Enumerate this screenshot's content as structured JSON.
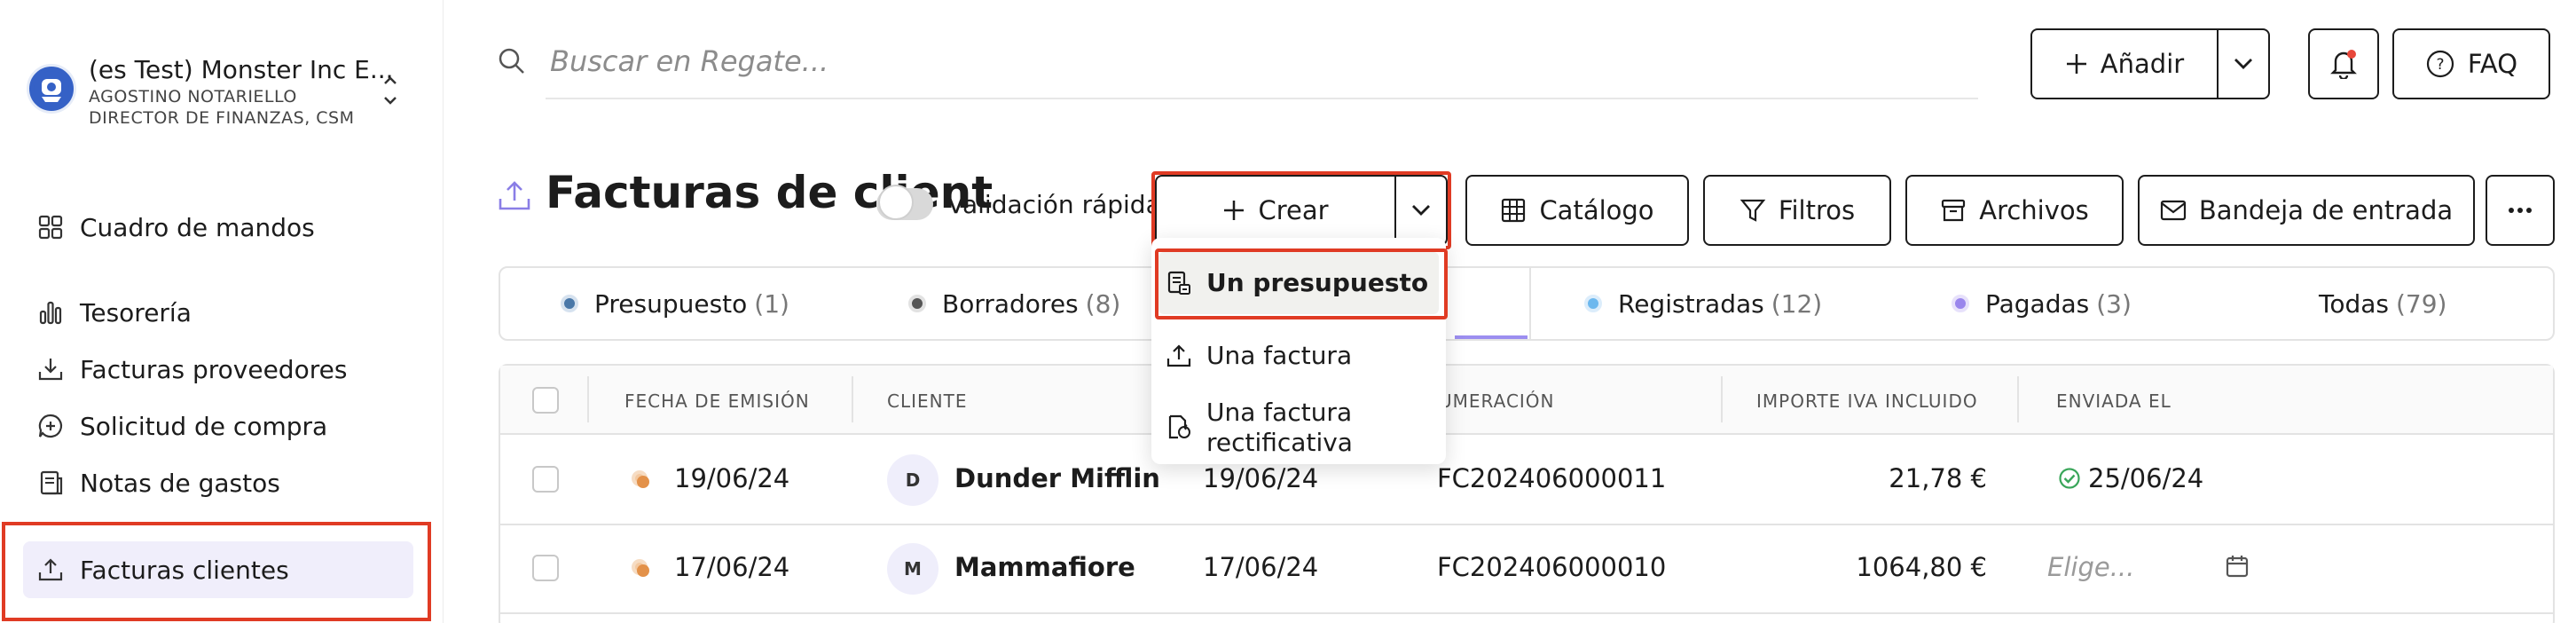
{
  "sidebar": {
    "company": {
      "name": "(es Test) Monster Inc E...",
      "user": "AGOSTINO NOTARIELLO",
      "role": "DIRECTOR DE FINANZAS, CSM"
    },
    "items": [
      {
        "label": "Cuadro de mandos",
        "icon": "dashboard-icon"
      },
      {
        "label": "Tesorería",
        "icon": "bar-chart-icon"
      },
      {
        "label": "Facturas proveedores",
        "icon": "download-tray-icon"
      },
      {
        "label": "Solicitud de compra",
        "icon": "plus-bubble-icon"
      },
      {
        "label": "Notas de gastos",
        "icon": "receipt-icon"
      },
      {
        "label": "Facturas clientes",
        "icon": "upload-tray-icon",
        "active": true
      }
    ]
  },
  "topbar": {
    "search_placeholder": "Buscar en Regate...",
    "add_label": "Añadir",
    "faq_label": "FAQ"
  },
  "page": {
    "title": "Facturas de client",
    "quick_validation_label": "Validación rápida",
    "quick_validation_on": false,
    "create_label": "Crear",
    "catalog_label": "Catálogo",
    "filters_label": "Filtros",
    "archives_label": "Archivos",
    "inbox_label": "Bandeja de entrada"
  },
  "create_menu": [
    {
      "label": "Un presupuesto",
      "icon": "quote-doc-icon",
      "highlighted": true
    },
    {
      "label": "Una factura",
      "icon": "upload-tray-icon"
    },
    {
      "label_line1": "Una factura",
      "label_line2": "rectificativa",
      "icon": "rectify-doc-icon"
    }
  ],
  "tabs": [
    {
      "label": "Presupuesto",
      "count": "(1)",
      "color": "#4a78a8"
    },
    {
      "label": "Borradores",
      "count": "(8)",
      "color": "#555555"
    },
    {
      "label": "Registradas",
      "count": "(12)",
      "color": "#6db8ee"
    },
    {
      "label": "Pagadas",
      "count": "(3)",
      "color": "#9a86ec"
    },
    {
      "label": "Todas",
      "count": "(79)"
    }
  ],
  "table": {
    "headers": [
      "FECHA DE EMISIÓN",
      "CLIENTE",
      "UMERACIÓN",
      "IMPORTE IVA INCLUIDO",
      "ENVIADA EL"
    ],
    "rows": [
      {
        "issue_date": "19/06/24",
        "avatar": "D",
        "client": "Dunder Mifflin",
        "date2": "19/06/24",
        "number": "FC202406000011",
        "amount": "21,78 €",
        "sent": "25/06/24",
        "sent_ok": true
      },
      {
        "issue_date": "17/06/24",
        "avatar": "M",
        "client": "Mammafiore",
        "date2": "17/06/24",
        "number": "FC202406000010",
        "amount": "1064,80 €",
        "sent_placeholder": "Elige..."
      }
    ]
  },
  "colors": {
    "accent_red": "#e03b24",
    "active_bg": "#f0eefb",
    "logo_blue": "#3561c6",
    "status_orange": "#e39149",
    "check_green": "#3aa65a"
  }
}
